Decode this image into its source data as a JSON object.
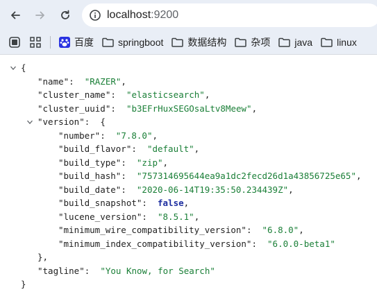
{
  "browser": {
    "url_host": "localhost",
    "url_port": ":9200"
  },
  "bookmarks": [
    {
      "label": "百度",
      "icon": "baidu-paw-icon"
    },
    {
      "label": "springboot",
      "icon": "folder-icon"
    },
    {
      "label": "数据结构",
      "icon": "folder-icon"
    },
    {
      "label": "杂项",
      "icon": "folder-icon"
    },
    {
      "label": "java",
      "icon": "folder-icon"
    },
    {
      "label": "linux",
      "icon": "folder-icon"
    }
  ],
  "json": {
    "open_brace": "{",
    "close_brace": "}",
    "name_key": "\"name\"",
    "name_val": "\"RAZER\"",
    "cluster_name_key": "\"cluster_name\"",
    "cluster_name_val": "\"elasticsearch\"",
    "cluster_uuid_key": "\"cluster_uuid\"",
    "cluster_uuid_val": "\"b3EFrHuxSEGOsaLtv8Meew\"",
    "version_key": "\"version\"",
    "version_open": "{",
    "version_close": "},",
    "number_key": "\"number\"",
    "number_val": "\"7.8.0\"",
    "build_flavor_key": "\"build_flavor\"",
    "build_flavor_val": "\"default\"",
    "build_type_key": "\"build_type\"",
    "build_type_val": "\"zip\"",
    "build_hash_key": "\"build_hash\"",
    "build_hash_val": "\"757314695644ea9a1dc2fecd26d1a43856725e65\"",
    "build_date_key": "\"build_date\"",
    "build_date_val": "\"2020-06-14T19:35:50.234439Z\"",
    "build_snapshot_key": "\"build_snapshot\"",
    "build_snapshot_val": "false",
    "lucene_version_key": "\"lucene_version\"",
    "lucene_version_val": "\"8.5.1\"",
    "min_wire_key": "\"minimum_wire_compatibility_version\"",
    "min_wire_val": "\"6.8.0\"",
    "min_index_key": "\"minimum_index_compatibility_version\"",
    "min_index_val": "\"6.0.0-beta1\"",
    "tagline_key": "\"tagline\"",
    "tagline_val": "\"You Know, for Search\""
  }
}
